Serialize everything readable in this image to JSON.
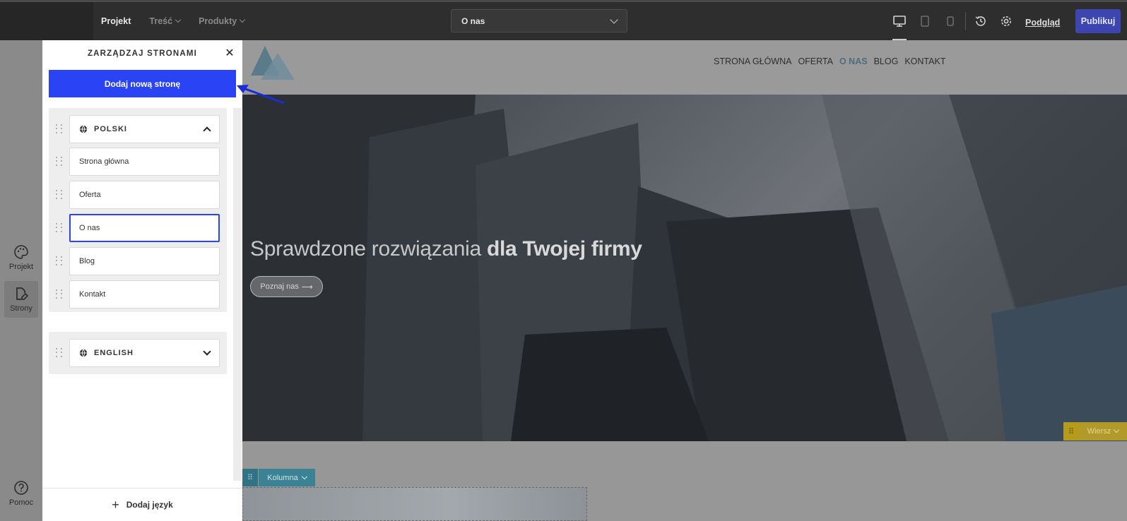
{
  "topbar": {
    "nav": [
      {
        "label": "Projekt",
        "active": true,
        "has_dropdown": false
      },
      {
        "label": "Treść",
        "active": false,
        "has_dropdown": true
      },
      {
        "label": "Produkty",
        "active": false,
        "has_dropdown": true
      }
    ],
    "page_select": {
      "value": "O nas"
    },
    "icons": [
      "desktop-icon",
      "tablet-icon",
      "mobile-icon",
      "history-icon",
      "gear-icon"
    ],
    "preview_label": "Podgląd",
    "publish_label": "Publikuj"
  },
  "rail": {
    "items": [
      {
        "label": "Projekt",
        "icon": "palette-icon",
        "active": false
      },
      {
        "label": "Strony",
        "icon": "page-edit-icon",
        "active": true
      },
      {
        "label": "Pomoc",
        "icon": "help-icon",
        "active": false
      }
    ]
  },
  "panel": {
    "title": "ZARZĄDZAJ STRONAMI",
    "add_page_label": "Dodaj nową stronę",
    "languages": [
      {
        "name": "POLSKI",
        "expanded": true,
        "pages": [
          {
            "label": "Strona główna",
            "selected": false
          },
          {
            "label": "Oferta",
            "selected": false
          },
          {
            "label": "O nas",
            "selected": true
          },
          {
            "label": "Blog",
            "selected": false
          },
          {
            "label": "Kontakt",
            "selected": false
          }
        ]
      },
      {
        "name": "ENGLISH",
        "expanded": false,
        "pages": []
      }
    ],
    "add_language_label": "Dodaj język"
  },
  "site": {
    "nav": [
      {
        "label": "STRONA GŁÓWNA",
        "active": false
      },
      {
        "label": "OFERTA",
        "active": false
      },
      {
        "label": "O NAS",
        "active": true
      },
      {
        "label": "BLOG",
        "active": false
      },
      {
        "label": "KONTAKT",
        "active": false
      }
    ],
    "hero": {
      "title_light": "Sprawdzone rozwiązania",
      "title_bold": "dla Twojej firmy",
      "button_label": "Poznaj nas"
    },
    "row_badge_label": "Wiersz",
    "column_badge_label": "Kolumna"
  },
  "colors": {
    "accent": "#2a43f5",
    "publish": "#3d46b0",
    "row_badge": "#b19a2a",
    "column_badge": "#3b8294",
    "topbar": "#2e2e2e"
  }
}
